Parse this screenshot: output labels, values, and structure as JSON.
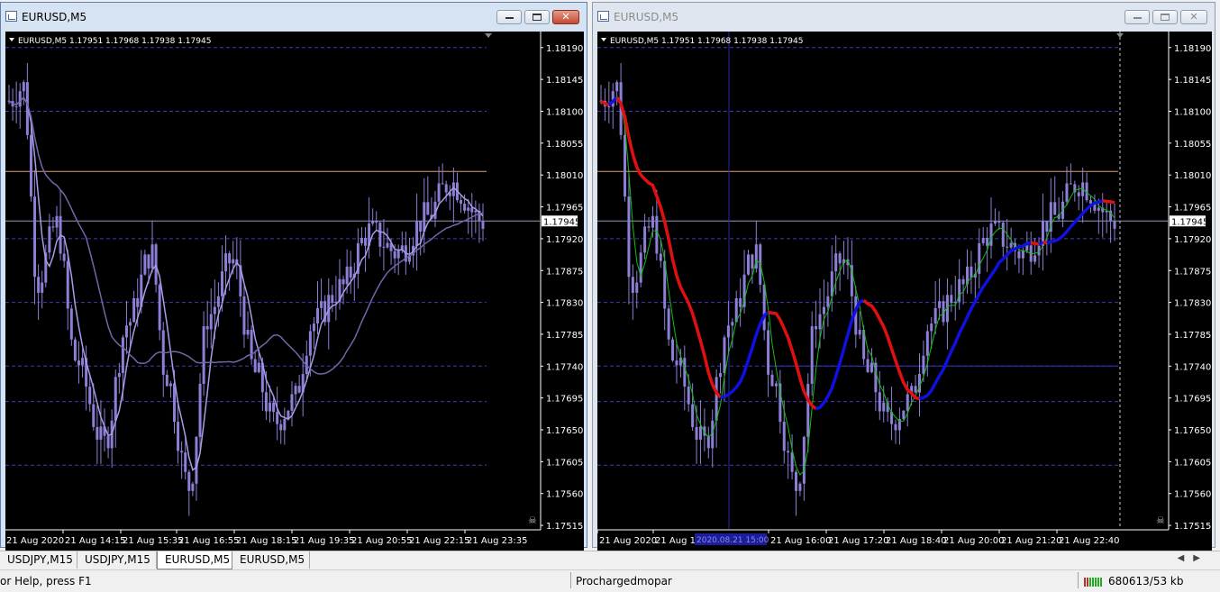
{
  "windows": [
    {
      "title": "EURUSD,M5",
      "state": "active",
      "info": "EURUSD,M5  1.17951 1.17968 1.17938 1.17945",
      "y_labels": [
        "1.18190",
        "1.18145",
        "1.18100",
        "1.18055",
        "1.18010",
        "1.17965",
        "1.17920",
        "1.17875",
        "1.17830",
        "1.17785",
        "1.17740",
        "1.17695",
        "1.17650",
        "1.17605",
        "1.17560",
        "1.17515"
      ],
      "price_tag": "1.17945",
      "x_labels": [
        "21 Aug 2020",
        "21 Aug 14:15",
        "21 Aug 15:35",
        "21 Aug 16:55",
        "21 Aug 18:15",
        "21 Aug 19:35",
        "21 Aug 20:55",
        "21 Aug 22:15",
        "21 Aug 23:35"
      ]
    },
    {
      "title": "EURUSD,M5",
      "state": "inactive",
      "info": "EURUSD,M5  1.17951 1.17968 1.17938 1.17945",
      "y_labels": [
        "1.18190",
        "1.18145",
        "1.18100",
        "1.18055",
        "1.18010",
        "1.17965",
        "1.17920",
        "1.17875",
        "1.17830",
        "1.17785",
        "1.17740",
        "1.17695",
        "1.17650",
        "1.17605",
        "1.17560",
        "1.17515"
      ],
      "price_tag": "1.17945",
      "x_labels": [
        "21 Aug 2020",
        "21 Aug 13",
        "21 Aug 16:00",
        "21 Aug 17:20",
        "21 Aug 18:40",
        "21 Aug 20:00",
        "21 Aug 21:20",
        "21 Aug 22:40"
      ],
      "crosshair_label": "2020.08.21 15:00"
    }
  ],
  "tabs": [
    "USDJPY,M15",
    "USDJPY,M15",
    "EURUSD,M5",
    "EURUSD,M5"
  ],
  "active_tab": 2,
  "status": {
    "help": "or Help, press F1",
    "profile": "Prochargedmopar",
    "connection": "680613/53 kb"
  },
  "colors": {
    "background": "#000000",
    "candles": "#8b7fd6",
    "grid": "#3d3dbd",
    "bid_line": "#8f98c0",
    "level_line": "#d9a070",
    "ma_red": "#e01010",
    "ma_blue": "#1010e0",
    "ma_green": "#10c010"
  }
}
